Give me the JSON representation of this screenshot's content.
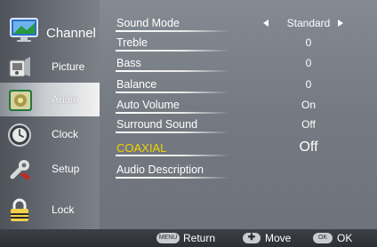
{
  "sidebar": {
    "items": [
      {
        "label": "Channel",
        "icon": "monitor-icon"
      },
      {
        "label": "Picture",
        "icon": "picture-icon"
      },
      {
        "label": "Audio",
        "icon": "audio-icon",
        "active": true
      },
      {
        "label": "Clock",
        "icon": "clock-icon"
      },
      {
        "label": "Setup",
        "icon": "setup-icon"
      },
      {
        "label": "Lock",
        "icon": "lock-icon"
      }
    ]
  },
  "menu": {
    "items": [
      {
        "label": "Sound Mode",
        "value": "Standard"
      },
      {
        "label": "Treble",
        "value": "0"
      },
      {
        "label": "Bass",
        "value": "0"
      },
      {
        "label": "Balance",
        "value": "0"
      },
      {
        "label": "Auto Volume",
        "value": "On"
      },
      {
        "label": "Surround Sound",
        "value": "Off"
      },
      {
        "label": "COAXIAL",
        "value": "Off"
      },
      {
        "label": "Audio Description",
        "value": ""
      }
    ]
  },
  "footer": {
    "menu_key": "MENU",
    "menu_label": "Return",
    "move_label": "Move",
    "ok_key": "OK",
    "ok_label": "OK"
  },
  "colors": {
    "highlight": "#f1d300",
    "text": "#ffffff"
  }
}
